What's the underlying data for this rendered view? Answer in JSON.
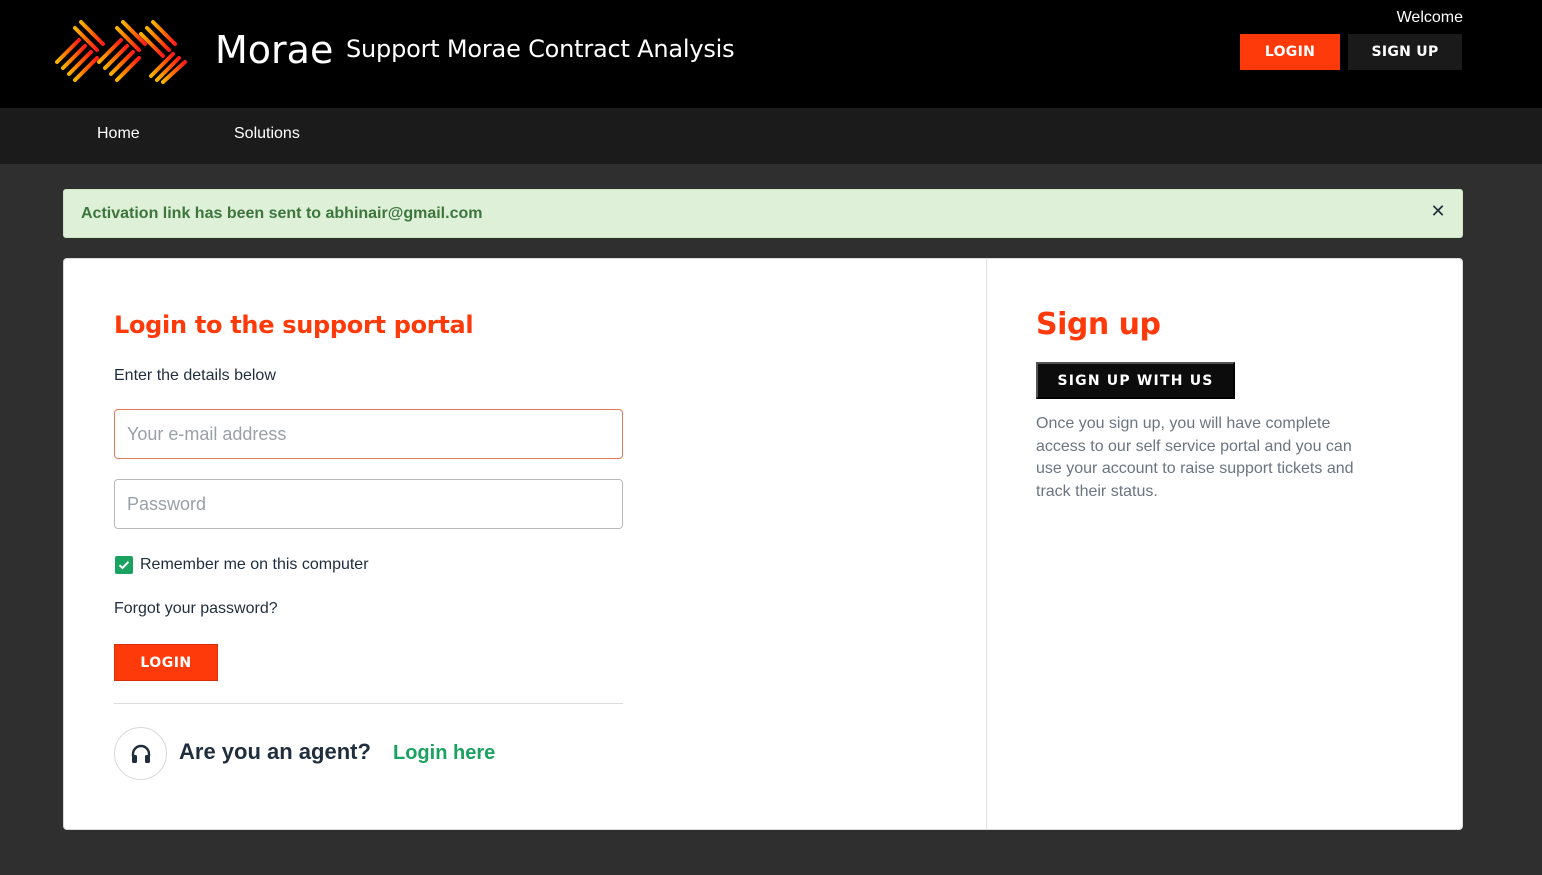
{
  "header": {
    "brand": "Morae",
    "portal_title": "Support Morae Contract Analysis",
    "welcome": "Welcome",
    "login_label": "LOGIN",
    "signup_label": "SIGN UP"
  },
  "nav": {
    "items": [
      {
        "label": "Home"
      },
      {
        "label": "Solutions"
      }
    ]
  },
  "alert": {
    "message": "Activation link has been sent to abhinair@gmail.com",
    "close_icon": "close-icon"
  },
  "login": {
    "heading": "Login to the support portal",
    "subheading": "Enter the details below",
    "email_placeholder": "Your e-mail address",
    "email_value": "",
    "password_placeholder": "Password",
    "password_value": "",
    "remember_label": "Remember me on this computer",
    "remember_checked": true,
    "forgot_label": "Forgot your password?",
    "button_label": "LOGIN",
    "agent_question": "Are you an agent?",
    "agent_link": "Login here",
    "agent_icon": "headset-icon"
  },
  "signup": {
    "heading": "Sign up",
    "button_label": "SIGN UP WITH US",
    "description": "Once you sign up, you will have complete access to our self service portal and you can use your account to raise support tickets and track their status."
  },
  "colors": {
    "accent": "#ff3a0a",
    "success": "#1aa260",
    "alert_bg": "#dff0d8",
    "alert_text": "#3c763d",
    "header_bg": "#000000",
    "nav_bg": "#1b1b1b",
    "page_bg": "#2f2f2f"
  }
}
